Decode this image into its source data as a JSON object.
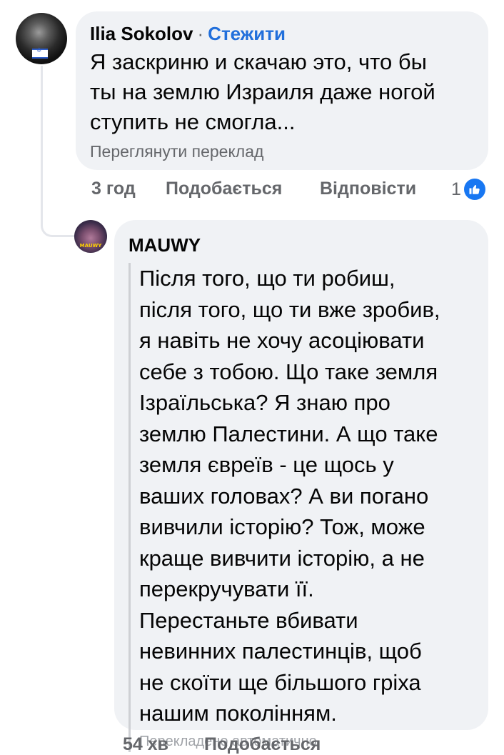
{
  "comment_1": {
    "author": "Ilia Sokolov",
    "separator": "·",
    "follow_label": "Стежити",
    "text_lines": [
      "Я заскриню и скачаю это, что бы",
      "ты на землю Израиля даже ногой",
      "ступить не смогла..."
    ],
    "see_translation": "Переглянути переклад",
    "time": "3 год",
    "like_label": "Подобається",
    "reply_label": "Відповісти",
    "reaction_count": "1",
    "reaction_icon": "like-thumb-icon"
  },
  "comment_2": {
    "author": "MAUWY",
    "avatar_text": "MAUWY",
    "text_lines": [
      "Після того, що ти робиш,",
      "після того, що ти вже зробив,",
      "я навіть не хочу асоціювати",
      "себе з тобою. Що таке земля",
      "Ізраїльська? Я знаю про",
      "землю Палестини. А що таке",
      "земля євреїв - це щось у",
      "ваших головах? А ви погано",
      "вивчили історію? Тож, може",
      "краще вивчити історію, а не",
      "перекручувати її.",
      "Перестаньте вбивати",
      "невинних палестинців, щоб",
      "не скоїти ще більшого гріха",
      "нашим поколінням."
    ],
    "auto_translated": "Перекладено автоматично",
    "time": "54 хв",
    "like_label": "Подобається"
  },
  "colors": {
    "bubble": "#f0f2f5",
    "link": "#216fdb",
    "secondary_text": "#65676b",
    "like_blue": "#1877f2"
  }
}
